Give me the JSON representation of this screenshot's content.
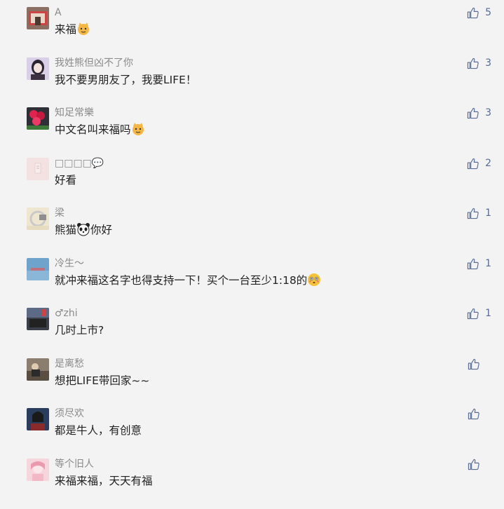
{
  "comments": [
    {
      "nick": "A",
      "text_parts": [
        "来福",
        ""
      ],
      "emoji": "cat-face-icon",
      "likes": "5"
    },
    {
      "nick": "我姓熊但凶不了你",
      "text_parts": [
        "我不要男朋友了，我要LIFE！",
        ""
      ],
      "emoji": "",
      "likes": "3"
    },
    {
      "nick": "知足常樂",
      "text_parts": [
        "中文名叫来福吗",
        ""
      ],
      "emoji": "cat-face-icon",
      "likes": "3"
    },
    {
      "nick": "□□□□💬",
      "text_parts": [
        "好看",
        ""
      ],
      "emoji": "",
      "likes": "2"
    },
    {
      "nick": "梁",
      "text_parts": [
        "熊猫",
        "你好"
      ],
      "emoji": "panda-face-icon",
      "likes": "1"
    },
    {
      "nick": "冷生～",
      "text_parts": [
        "就冲来福这名字也得支持一下！买个一台至少1:18的",
        ""
      ],
      "emoji": "flushed-face-icon",
      "likes": "1"
    },
    {
      "nick": "♂zhi",
      "text_parts": [
        "几时上市?",
        ""
      ],
      "emoji": "",
      "likes": "1"
    },
    {
      "nick": "是离愁",
      "text_parts": [
        "想把LIFE带回家~~",
        ""
      ],
      "emoji": "",
      "likes": ""
    },
    {
      "nick": "须尽欢",
      "text_parts": [
        "都是牛人，有创意",
        ""
      ],
      "emoji": "",
      "likes": ""
    },
    {
      "nick": "等个旧人",
      "text_parts": [
        "来福来福，天天有福",
        ""
      ],
      "emoji": "",
      "likes": ""
    }
  ],
  "colors": {
    "background": "#f3f3f3",
    "nickname": "#8a8a8a",
    "like": "#576b95",
    "text": "#222222"
  }
}
